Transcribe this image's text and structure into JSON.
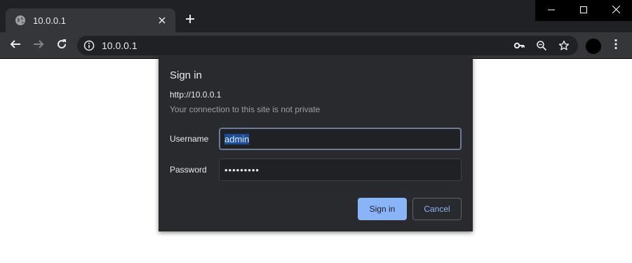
{
  "browser": {
    "tab": {
      "title": "10.0.0.1",
      "favicon": "globe-icon",
      "close_icon": "close-icon"
    },
    "new_tab_icon": "plus-icon",
    "window_controls": [
      "minimize-icon",
      "maximize-icon",
      "close-icon"
    ],
    "toolbar": {
      "back_icon": "back-arrow-icon",
      "forward_icon": "forward-arrow-icon",
      "reload_icon": "reload-icon",
      "address": "10.0.0.1",
      "site_info_icon": "info-icon",
      "omnibox_icons": [
        "key-icon",
        "zoom-out-icon",
        "star-icon"
      ],
      "menu_icon": "kebab-menu-icon"
    }
  },
  "dialog": {
    "title": "Sign in",
    "origin": "http://10.0.0.1",
    "warning": "Your connection to this site is not private",
    "username_label": "Username",
    "username_value": "admin",
    "password_label": "Password",
    "password_value": "•••••••••",
    "sign_in_label": "Sign in",
    "cancel_label": "Cancel"
  },
  "colors": {
    "tabstrip": "#202124",
    "toolbar": "#35363a",
    "dialog_bg": "#292a2d",
    "accent": "#8ab4f8",
    "selection": "#1a4d9c"
  }
}
